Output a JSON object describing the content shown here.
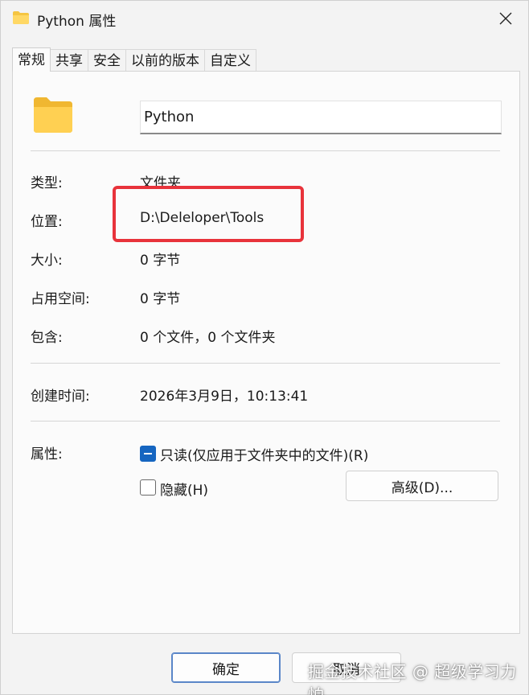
{
  "window": {
    "title": "Python 属性"
  },
  "tabs": [
    {
      "label": "常规",
      "active": true
    },
    {
      "label": "共享",
      "active": false
    },
    {
      "label": "安全",
      "active": false
    },
    {
      "label": "以前的版本",
      "active": false
    },
    {
      "label": "自定义",
      "active": false
    }
  ],
  "general": {
    "name_value": "Python",
    "rows": [
      {
        "label": "类型:",
        "value": "文件夹"
      },
      {
        "label": "位置:",
        "value": "D:\\Deleloper\\Tools"
      },
      {
        "label": "大小:",
        "value": "0 字节"
      },
      {
        "label": "占用空间:",
        "value": "0 字节"
      },
      {
        "label": "包含:",
        "value": "0 个文件，0 个文件夹"
      },
      {
        "label": "创建时间:",
        "value": "2026年3月9日，10:13:41"
      }
    ],
    "attributes_label": "属性:",
    "readonly_label": "只读(仅应用于文件夹中的文件)(R)",
    "readonly_state": "indeterminate",
    "hidden_label": "隐藏(H)",
    "hidden_state": "unchecked",
    "advanced_label": "高级(D)..."
  },
  "footer": {
    "ok_label": "确定",
    "cancel_label": "取消"
  },
  "watermark": "掘金技术社区 @ 超级学习力怕",
  "colors": {
    "accent": "#1565c0",
    "highlight": "#e8333b"
  }
}
